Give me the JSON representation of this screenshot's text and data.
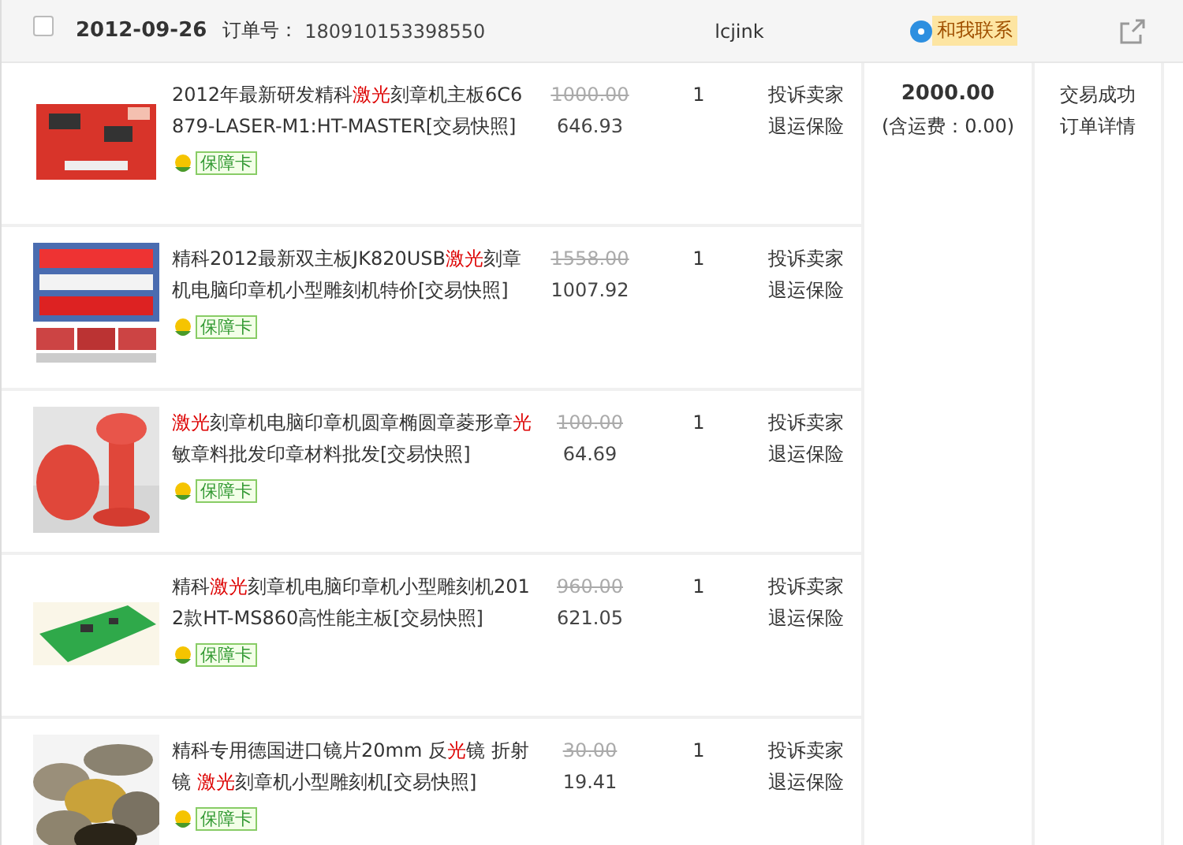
{
  "order": {
    "checked": false,
    "date": "2012-09-26",
    "number_label": "订单号：",
    "number": "180910153398550",
    "seller": "lcjink",
    "contact": "和我联系"
  },
  "items": [
    {
      "title": [
        {
          "text": "2012年最新研发精科",
          "highlight": false
        },
        {
          "text": "激光",
          "highlight": true
        },
        {
          "text": "刻章机主板6C6879-LASER-M1:HT-MASTER[交易快照]",
          "highlight": false
        }
      ],
      "badge": "保障卡",
      "original_price": "1000.00",
      "price": "646.93",
      "quantity": "1",
      "actions": [
        "投诉卖家",
        "退运保险"
      ]
    },
    {
      "title": [
        {
          "text": "精科2012最新双主板JK820USB",
          "highlight": false
        },
        {
          "text": "激光",
          "highlight": true
        },
        {
          "text": "刻章机电脑印章机小型雕刻机特价[交易快照]",
          "highlight": false
        }
      ],
      "badge": "保障卡",
      "original_price": "1558.00",
      "price": "1007.92",
      "quantity": "1",
      "actions": [
        "投诉卖家",
        "退运保险"
      ]
    },
    {
      "title": [
        {
          "text": "激光",
          "highlight": true
        },
        {
          "text": "刻章机电脑印章机圆章椭圆章菱形章",
          "highlight": false
        },
        {
          "text": "光",
          "highlight": true
        },
        {
          "text": "敏章料批发印章材料批发[交易快照]",
          "highlight": false
        }
      ],
      "badge": "保障卡",
      "original_price": "100.00",
      "price": "64.69",
      "quantity": "1",
      "actions": [
        "投诉卖家",
        "退运保险"
      ]
    },
    {
      "title": [
        {
          "text": "精科",
          "highlight": false
        },
        {
          "text": "激光",
          "highlight": true
        },
        {
          "text": "刻章机电脑印章机小型雕刻机2012款HT-MS860高性能主板[交易快照]",
          "highlight": false
        }
      ],
      "badge": "保障卡",
      "original_price": "960.00",
      "price": "621.05",
      "quantity": "1",
      "actions": [
        "投诉卖家",
        "退运保险"
      ]
    },
    {
      "title": [
        {
          "text": "精科专用德国进口镜片20mm 反",
          "highlight": false
        },
        {
          "text": "光",
          "highlight": true
        },
        {
          "text": "镜 折射镜 ",
          "highlight": false
        },
        {
          "text": "激光",
          "highlight": true
        },
        {
          "text": "刻章机小型雕刻机[交易快照]",
          "highlight": false
        }
      ],
      "badge": "保障卡",
      "original_price": "30.00",
      "price": "19.41",
      "quantity": "1",
      "actions": [
        "投诉卖家",
        "退运保险"
      ]
    }
  ],
  "total": {
    "amount": "2000.00",
    "shipping": "(含运费：0.00)"
  },
  "status": {
    "text": "交易成功",
    "link": "订单详情"
  }
}
